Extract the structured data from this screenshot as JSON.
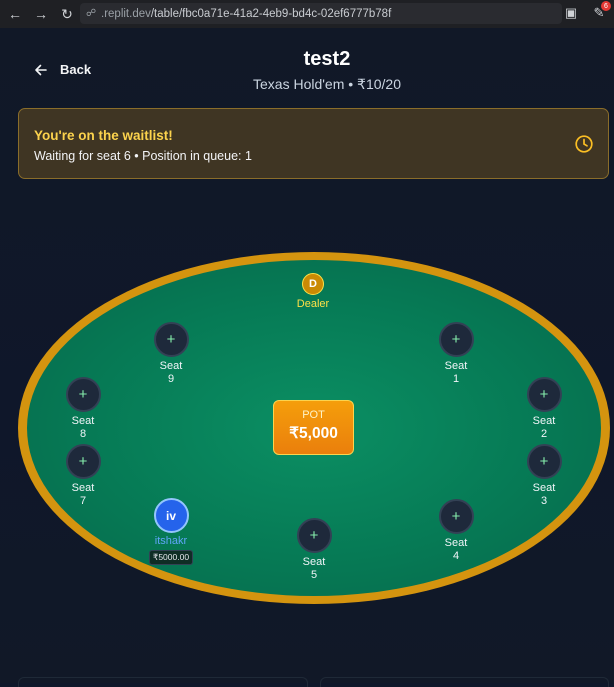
{
  "browser": {
    "url_prefix": ".replit.dev",
    "url_path": "/table/fbc0a71e-41a2-4eb9-bd4c-02ef6777b78f",
    "notification_count": "6"
  },
  "header": {
    "back_label": "Back",
    "title": "test2",
    "subtitle": "Texas Hold'em • ₹10/20"
  },
  "waitlist": {
    "title": "You're on the waitlist!",
    "text": "Waiting for seat 6 • Position in queue: 1"
  },
  "table": {
    "dealer_badge": "D",
    "dealer_label": "Dealer",
    "pot_label": "POT",
    "pot_value": "₹5,000",
    "seats": [
      {
        "word": "Seat",
        "num": "1",
        "icon": "+"
      },
      {
        "word": "Seat",
        "num": "2",
        "icon": "+"
      },
      {
        "word": "Seat",
        "num": "3",
        "icon": "+"
      },
      {
        "word": "Seat",
        "num": "4",
        "icon": "+"
      },
      {
        "word": "Seat",
        "num": "5",
        "icon": "+"
      },
      {
        "word": "Seat",
        "num": "7",
        "icon": "+"
      },
      {
        "word": "Seat",
        "num": "8",
        "icon": "+"
      },
      {
        "word": "Seat",
        "num": "9",
        "icon": "+"
      }
    ],
    "player": {
      "initials": "iv",
      "name": "itshakr",
      "stack": "₹5000.00"
    }
  },
  "colors": {
    "felt": "#067a55",
    "rim": "#d4940f",
    "pot": "#f59e0b",
    "waitlist_bg": "#3f3523",
    "waitlist_title": "#fcd34d",
    "player_avatar": "#2563eb"
  },
  "icons": {
    "back": "arrow-left-icon",
    "clock": "clock-icon",
    "empty_seat": "plus-icon"
  }
}
